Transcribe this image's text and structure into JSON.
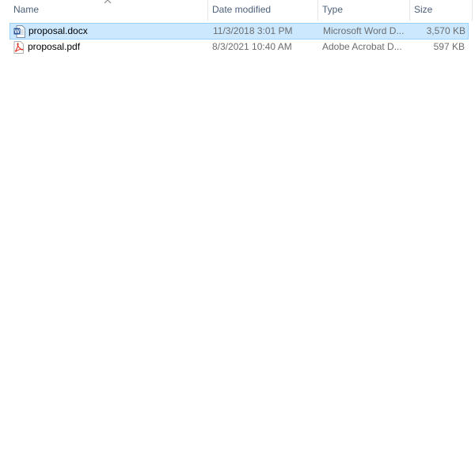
{
  "columns": {
    "name": "Name",
    "date": "Date modified",
    "type": "Type",
    "size": "Size"
  },
  "sort": {
    "column": "name",
    "direction": "ascending",
    "icon": "chevron-up-icon"
  },
  "files": [
    {
      "name": "proposal.docx",
      "date": "11/3/2018 3:01 PM",
      "type": "Microsoft Word D...",
      "size": "3,570 KB",
      "icon": "word-document-icon",
      "selected": true
    },
    {
      "name": "proposal.pdf",
      "date": "8/3/2021 10:40 AM",
      "type": "Adobe Acrobat D...",
      "size": "597 KB",
      "icon": "pdf-document-icon",
      "selected": false
    }
  ],
  "colors": {
    "selection_bg": "#cce8ff",
    "selection_border": "#99d1ff",
    "header_text": "#4c607a",
    "detail_text": "#6d6d6d",
    "word_blue": "#2b579a",
    "pdf_red": "#e0281c"
  }
}
